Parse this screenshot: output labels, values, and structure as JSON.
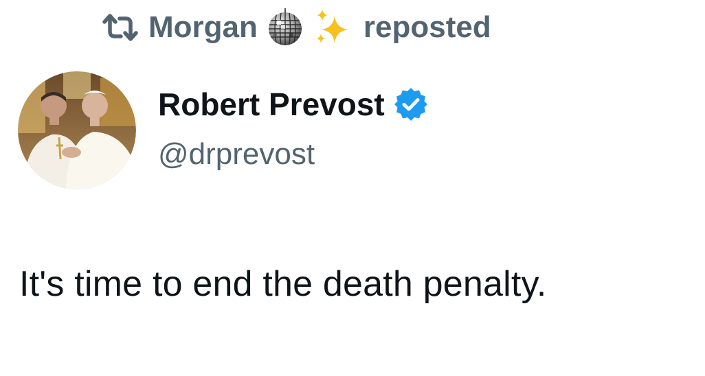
{
  "repost": {
    "icon": "repost-icon",
    "user_name": "Morgan",
    "emoji_1": "mirror-ball-icon",
    "emoji_2": "sparkles-icon",
    "action_label": "reposted"
  },
  "author": {
    "avatar": "avatar-photo",
    "display_name": "Robert Prevost",
    "verified_icon": "verified-badge-icon",
    "handle": "@drprevost"
  },
  "tweet": {
    "text": "It's time to end the death penalty."
  },
  "colors": {
    "primary_text": "#0f1419",
    "secondary_text": "#536471",
    "verified_blue": "#1d9bf0",
    "background": "#ffffff"
  }
}
